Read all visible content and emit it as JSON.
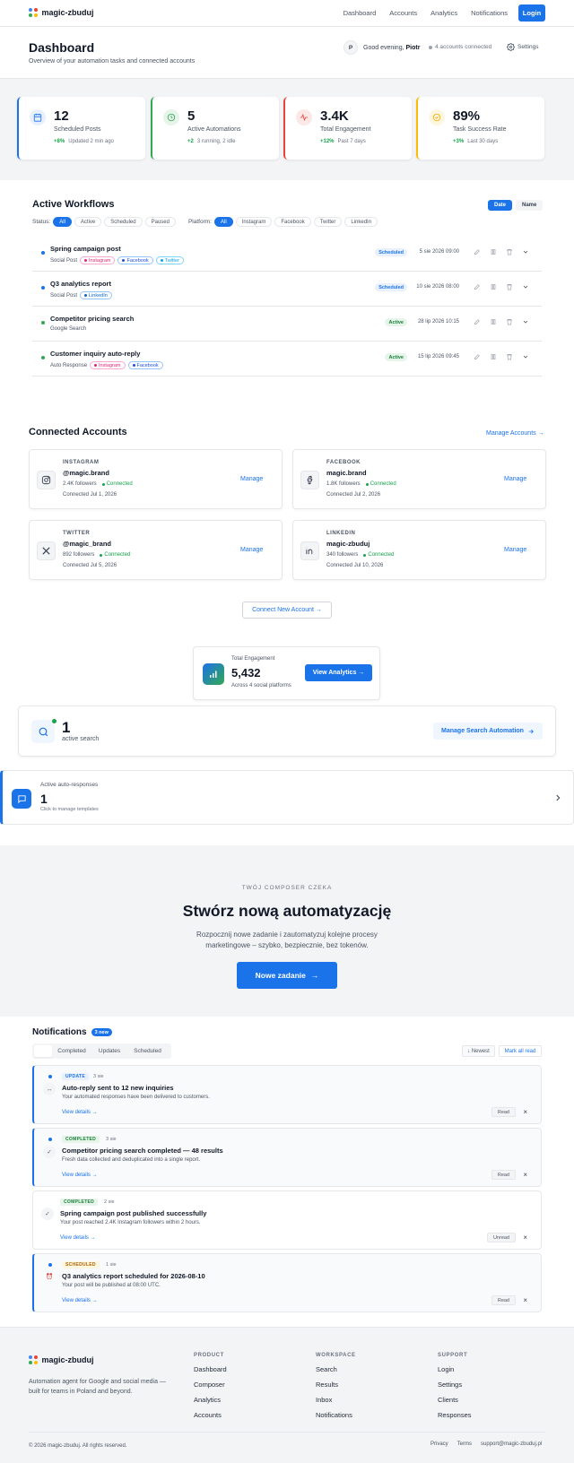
{
  "brand": {
    "name": "magic-zbuduj",
    "dot_colors": [
      "#4285f4",
      "#ea4335",
      "#34a853",
      "#fbbc05"
    ]
  },
  "nav": {
    "items": [
      "Dashboard",
      "Accounts",
      "Analytics",
      "Notifications"
    ],
    "login": "Login"
  },
  "dashboard": {
    "title": "Dashboard",
    "subtitle": "Overview of your automation tasks and connected accounts",
    "avatar": "P",
    "greeting": "Good evening,",
    "user": "Piotr",
    "accounts_connected": "4 accounts connected",
    "settings": "Settings"
  },
  "stats": [
    {
      "value": "12",
      "label": "Scheduled Posts",
      "delta": "+8%",
      "meta": "Updated 2 min ago",
      "color": "#1a73e8",
      "icon": "calendar-icon"
    },
    {
      "value": "5",
      "label": "Active Automations",
      "delta": "+2",
      "meta": "3 running, 2 idle",
      "color": "#34a853",
      "icon": "clock-icon"
    },
    {
      "value": "3.4K",
      "label": "Total Engagement",
      "delta": "+12%",
      "meta": "Past 7 days",
      "color": "#ea4335",
      "icon": "pulse-icon"
    },
    {
      "value": "89%",
      "label": "Task Success Rate",
      "delta": "+3%",
      "meta": "Last 30 days",
      "color": "#fbbc05",
      "icon": "check-circle-icon"
    }
  ],
  "workflows": {
    "title": "Active Workflows",
    "sort": [
      "Date",
      "Name"
    ],
    "status_label": "Status:",
    "status_filters": [
      "All",
      "Active",
      "Scheduled",
      "Paused"
    ],
    "platform_label": "Platform:",
    "platform_filters": [
      "All",
      "Instagram",
      "Facebook",
      "Twitter",
      "LinkedIn"
    ],
    "rows": [
      {
        "title": "Spring campaign post",
        "type": "Social Post",
        "platforms": [
          "Instagram",
          "Facebook",
          "Twitter"
        ],
        "status": "Scheduled",
        "date": "5 sie 2026 09:00",
        "dot": "#1a73e8"
      },
      {
        "title": "Q3 analytics report",
        "type": "Social Post",
        "platforms": [
          "LinkedIn"
        ],
        "status": "Scheduled",
        "date": "10 sie 2026 08:00",
        "dot": "#1a73e8"
      },
      {
        "title": "Competitor pricing search",
        "type": "Google Search",
        "platforms": [],
        "status": "Active",
        "date": "28 lip 2026 10:15",
        "dot": "#34a853"
      },
      {
        "title": "Customer inquiry auto-reply",
        "type": "Auto Response",
        "platforms": [
          "Instagram",
          "Facebook"
        ],
        "status": "Active",
        "date": "15 lip 2026 09:45",
        "dot": "#34a853"
      }
    ]
  },
  "accounts": {
    "title": "Connected Accounts",
    "manage_all": "Manage Accounts →",
    "cards": [
      {
        "platform": "INSTAGRAM",
        "handle": "@magic.brand",
        "followers": "2.4K followers",
        "status": "Connected",
        "since": "Connected Jul 1, 2026",
        "manage": "Manage",
        "icon": "instagram-icon"
      },
      {
        "platform": "FACEBOOK",
        "handle": "magic.brand",
        "followers": "1.8K followers",
        "status": "Connected",
        "since": "Connected Jul 2, 2026",
        "manage": "Manage",
        "icon": "facebook-icon"
      },
      {
        "platform": "TWITTER",
        "handle": "@magic_brand",
        "followers": "892 followers",
        "status": "Connected",
        "since": "Connected Jul 5, 2026",
        "manage": "Manage",
        "icon": "x-twitter-icon"
      },
      {
        "platform": "LINKEDIN",
        "handle": "magic-zbuduj",
        "followers": "340 followers",
        "status": "Connected",
        "since": "Connected Jul 10, 2026",
        "manage": "Manage",
        "icon": "linkedin-icon"
      }
    ],
    "connect_new": "Connect New Account →"
  },
  "engagement": {
    "label": "Total Engagement",
    "value": "5,432",
    "sub": "Across 4 social platforms",
    "button": "View Analytics →"
  },
  "search": {
    "value": "1",
    "label": "active search",
    "button": "Manage Search Automation"
  },
  "auto": {
    "label": "Active auto-responses",
    "value": "1",
    "sub": "Click to manage templates"
  },
  "cta": {
    "eyebrow": "TWÓJ COMPOSER CZEKA",
    "title": "Stwórz nową automatyzację",
    "text": "Rozpocznij nowe zadanie i zautomatyzuj kolejne procesy marketingowe – szybko, bezpiecznie, bez tokenów.",
    "button": "Nowe zadanie"
  },
  "notifications": {
    "title": "Notifications",
    "new_badge": "3 new",
    "tabs": [
      "",
      "Completed",
      "Updates",
      "Scheduled"
    ],
    "sort": "↓ Newest",
    "mark_all": "Mark all read",
    "items": [
      {
        "tag": "UPDATE",
        "time": "3 sie",
        "title": "Auto-reply sent to 12 new inquiries",
        "desc": "Your automated responses have been delivered to customers.",
        "link": "View details →",
        "action": "Read",
        "unread": true,
        "icon": "↔"
      },
      {
        "tag": "COMPLETED",
        "time": "3 sie",
        "title": "Competitor pricing search completed — 48 results",
        "desc": "Fresh data collected and deduplicated into a single report.",
        "link": "View details →",
        "action": "Read",
        "unread": true,
        "icon": "✓"
      },
      {
        "tag": "COMPLETED",
        "time": "2 sie",
        "title": "Spring campaign post published successfully",
        "desc": "Your post reached 2.4K Instagram followers within 2 hours.",
        "link": "View details →",
        "action": "Unread",
        "unread": false,
        "icon": "✓"
      },
      {
        "tag": "SCHEDULED",
        "time": "1 sie",
        "title": "Q3 analytics report scheduled for 2026-08-10",
        "desc": "Your post will be published at 08:00 UTC.",
        "link": "View details →",
        "action": "Read",
        "unread": true,
        "icon": "⏰"
      }
    ]
  },
  "footer": {
    "desc": "Automation agent for Google and social media — built for teams in Poland and beyond.",
    "columns": [
      {
        "heading": "PRODUCT",
        "items": [
          "Dashboard",
          "Composer",
          "Analytics",
          "Accounts"
        ]
      },
      {
        "heading": "WORKSPACE",
        "items": [
          "Search",
          "Results",
          "Inbox",
          "Notifications"
        ]
      },
      {
        "heading": "SUPPORT",
        "items": [
          "Login",
          "Settings",
          "Clients",
          "Responses"
        ]
      }
    ],
    "copyright": "© 2026 magic-zbuduj. All rights reserved.",
    "links": [
      "Privacy",
      "Terms",
      "support@magic-zbuduj.pl"
    ]
  }
}
